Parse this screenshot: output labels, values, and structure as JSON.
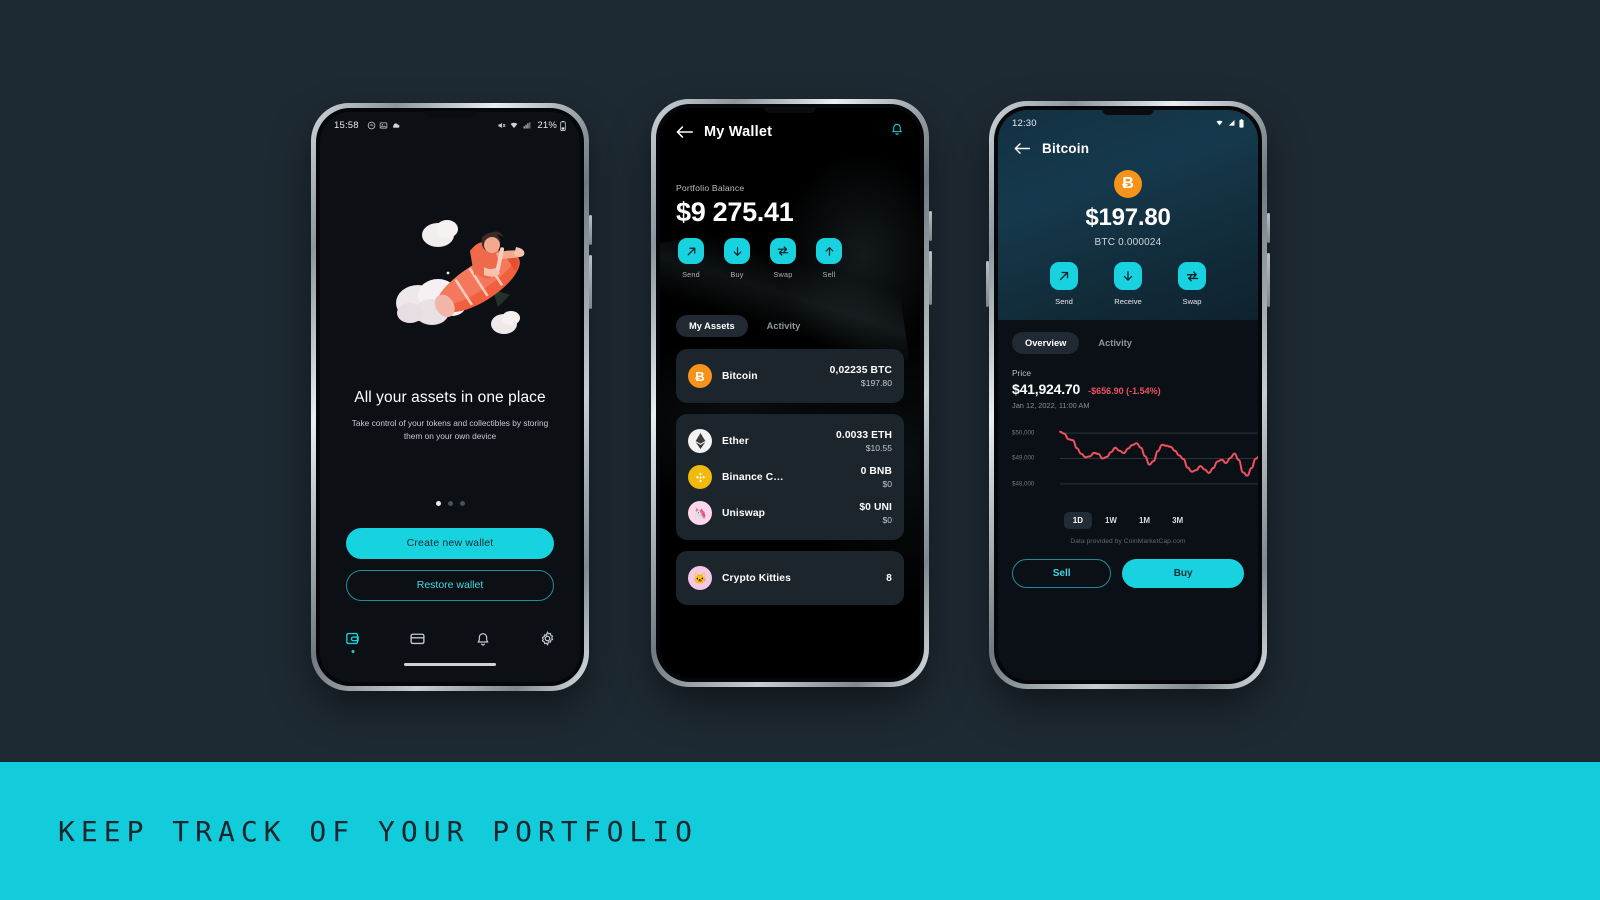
{
  "background_color": "#1e2a33",
  "accent_color": "#19d2e0",
  "banner": {
    "text": "KEEP TRACK OF YOUR PORTFOLIO",
    "background_color": "#12ccdb",
    "text_color": "#16262c"
  },
  "phone1": {
    "statusbar": {
      "time": "15:58",
      "battery": "21%",
      "left_icons": [
        "message-icon",
        "photo-icon",
        "cloud-icon"
      ],
      "right_icons": [
        "mute-icon",
        "wifi-icon",
        "signal-icon",
        "battery-icon"
      ]
    },
    "illustration": "person-riding-rocket-illustration",
    "title": "All your assets in one place",
    "subtitle": "Take control of your tokens and collectibles by storing them on your own device",
    "pager": {
      "count": 3,
      "active_index": 0
    },
    "primary_button": "Create new wallet",
    "secondary_button": "Restore wallet",
    "tabs": [
      {
        "name": "wallet",
        "icon": "wallet-icon",
        "active": true
      },
      {
        "name": "card",
        "icon": "card-icon",
        "active": false
      },
      {
        "name": "notifications",
        "icon": "bell-icon",
        "active": false
      },
      {
        "name": "settings",
        "icon": "gear-icon",
        "active": false
      }
    ]
  },
  "phone2": {
    "header": {
      "back": "back-arrow-icon",
      "title": "My Wallet",
      "bell": "bell-icon"
    },
    "balance_label": "Portfolio Balance",
    "balance": "$9 275.41",
    "actions": [
      {
        "label": "Send",
        "icon": "arrow-up-right-icon"
      },
      {
        "label": "Buy",
        "icon": "arrow-down-icon"
      },
      {
        "label": "Swap",
        "icon": "swap-arrows-icon"
      },
      {
        "label": "Sell",
        "icon": "arrow-up-icon"
      }
    ],
    "tabs": [
      {
        "label": "My Assets",
        "active": true
      },
      {
        "label": "Activity",
        "active": false
      }
    ],
    "assets_group_1": [
      {
        "name": "Bitcoin",
        "amount": "0,02235 BTC",
        "fiat": "$197.80",
        "symbol": "Ƀ",
        "color": "#f7931a"
      }
    ],
    "assets_group_2": [
      {
        "name": "Ether",
        "amount": "0.0033 ETH",
        "fiat": "$10.55",
        "symbol": "♦",
        "color": "#f4f4f4"
      },
      {
        "name": "Binance C…",
        "amount": "0 BNB",
        "fiat": "$0",
        "symbol": "◆",
        "color": "#f0b90b"
      },
      {
        "name": "Uniswap",
        "amount": "$0 UNI",
        "fiat": "$0",
        "symbol": "🦄",
        "color": "#ffd7ea"
      }
    ],
    "assets_group_3": [
      {
        "name": "Crypto Kitties",
        "amount": "8",
        "fiat": "",
        "symbol": "🐱",
        "color": "#f3c7e6"
      }
    ]
  },
  "phone3": {
    "statusbar": {
      "time": "12:30",
      "right_icons": [
        "wifi-icon",
        "signal-icon",
        "battery-icon"
      ]
    },
    "header": {
      "back": "back-arrow-icon",
      "title": "Bitcoin"
    },
    "coin_symbol": "Ƀ",
    "coin_color": "#f7931a",
    "fiat_value": "$197.80",
    "crypto_value": "BTC 0.000024",
    "actions": [
      {
        "label": "Send",
        "icon": "arrow-up-right-icon"
      },
      {
        "label": "Receive",
        "icon": "arrow-down-icon"
      },
      {
        "label": "Swap",
        "icon": "swap-arrows-icon"
      }
    ],
    "tabs": [
      {
        "label": "Overview",
        "active": true
      },
      {
        "label": "Activity",
        "active": false
      }
    ],
    "price_label": "Price",
    "price": "$41,924.70",
    "change": "-$656.90 (-1.54%)",
    "timestamp": "Jan 12, 2022, 11:00 AM",
    "ranges": [
      {
        "label": "1D",
        "active": true
      },
      {
        "label": "1W",
        "active": false
      },
      {
        "label": "1M",
        "active": false
      },
      {
        "label": "3M",
        "active": false
      }
    ],
    "credit": "Data provided by CoinMarketCap.com",
    "sell_button": "Sell",
    "buy_button": "Buy"
  },
  "chart_data": {
    "type": "line",
    "title": "Bitcoin price 1D",
    "xlabel": "",
    "ylabel": "",
    "ylim": [
      47600,
      50200
    ],
    "grid": true,
    "legend": "none",
    "line_color": "#ef5160",
    "ytick_labels": [
      "$50,000",
      "$49,000",
      "$48,000"
    ],
    "yticks": [
      50000,
      49000,
      48000
    ],
    "x": [
      0,
      1,
      2,
      3,
      4,
      5,
      6,
      7,
      8,
      9,
      10,
      11,
      12,
      13,
      14,
      15,
      16,
      17,
      18,
      19,
      20,
      21,
      22,
      23,
      24,
      25,
      26,
      27,
      28,
      29,
      30,
      31,
      32,
      33,
      34,
      35,
      36,
      37,
      38,
      39,
      40,
      41,
      42,
      43,
      44,
      45,
      46,
      47
    ],
    "values": [
      50050,
      49980,
      49760,
      49720,
      49400,
      49180,
      49050,
      49080,
      49220,
      49180,
      49000,
      49060,
      49250,
      49420,
      49300,
      49210,
      49390,
      49530,
      49600,
      49420,
      49090,
      48760,
      48900,
      49290,
      49540,
      49500,
      49460,
      49300,
      49120,
      48980,
      48640,
      48480,
      48540,
      48700,
      48560,
      48430,
      48620,
      48880,
      48950,
      48820,
      49020,
      49190,
      48940,
      48450,
      48320,
      48620,
      48990,
      49110
    ]
  }
}
